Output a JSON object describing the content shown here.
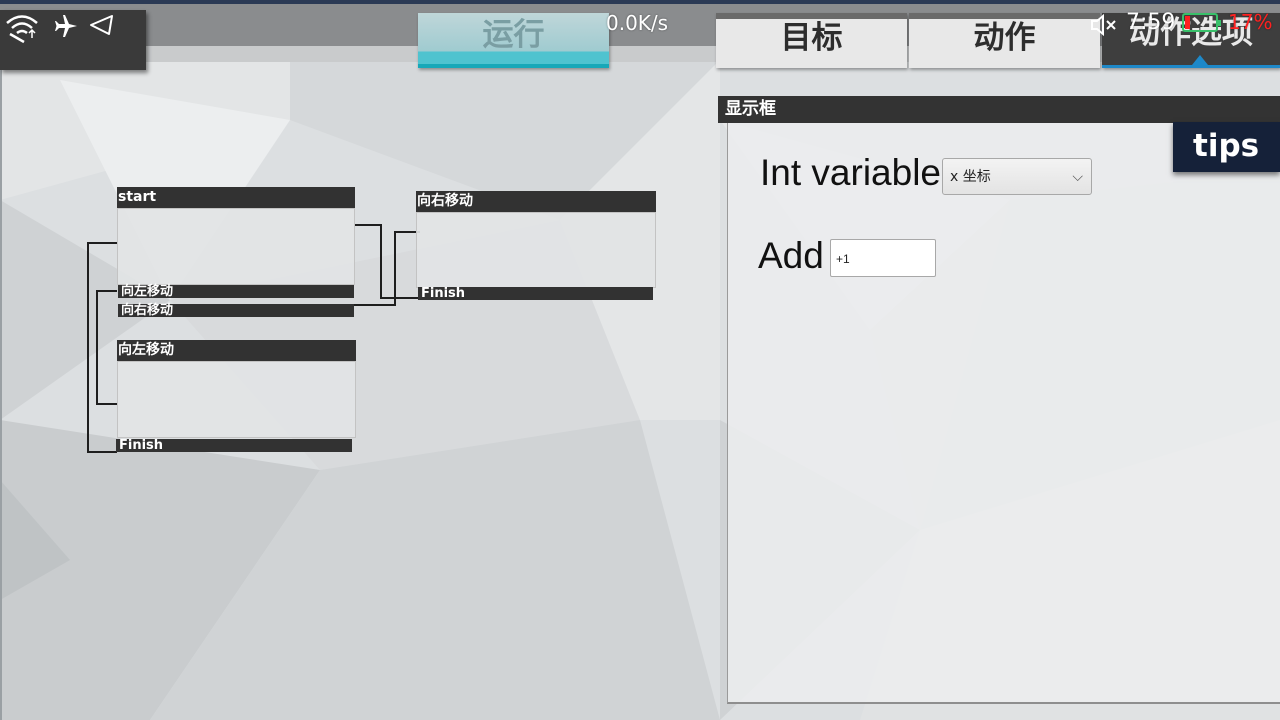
{
  "statusbar": {
    "speed": "0.0K/s",
    "time": "7:59",
    "battery_percent": "17%",
    "battery_level": 0.17,
    "icons": [
      "wifi-icon",
      "airplane-mode-icon",
      "location-arrow-icon",
      "mute-icon",
      "battery-icon"
    ],
    "colors": {
      "battery_low": "#ff2020",
      "battery_frame": "#39c06a"
    }
  },
  "tabs": [
    {
      "label": "运行",
      "state": "active-running"
    },
    {
      "label": "目标"
    },
    {
      "label": "动作"
    },
    {
      "label": "动作选项",
      "state": "selected"
    }
  ],
  "colors": {
    "accent": "#17a8b8",
    "options_accent": "#1e88c8",
    "header_dark": "#323232",
    "tips_bg": "#152139"
  },
  "graph": {
    "start_node": {
      "title": "start",
      "ports": [
        "向左移动",
        "向右移动"
      ]
    },
    "right_node": {
      "title": "向右移动",
      "ports": [
        "Finish"
      ]
    },
    "left_node": {
      "title": "向左移动",
      "ports": [
        "Finish"
      ]
    }
  },
  "panel": {
    "title": "显示框",
    "int_variable_label": "Int variable",
    "int_variable_value": "x 坐标",
    "add_label": "Add",
    "add_value": "+1"
  },
  "tips_label": "tips"
}
